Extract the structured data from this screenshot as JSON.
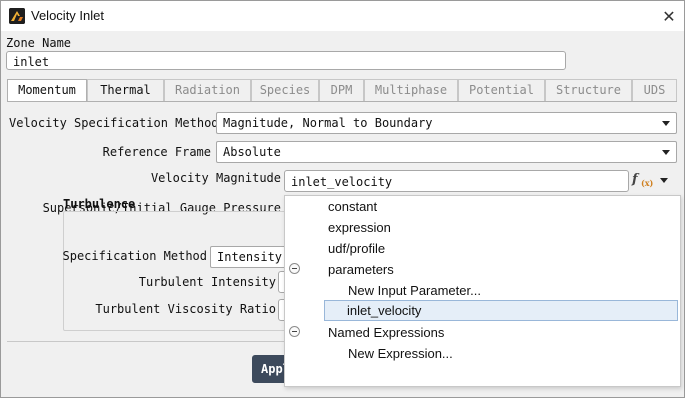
{
  "window": {
    "title": "Velocity Inlet",
    "close_glyph": "✕"
  },
  "zone": {
    "label": "Zone Name",
    "value": "inlet"
  },
  "tabs": [
    {
      "label": "Momentum",
      "active": true
    },
    {
      "label": "Thermal",
      "active": false
    },
    {
      "label": "Radiation",
      "active": false
    },
    {
      "label": "Species",
      "active": false
    },
    {
      "label": "DPM",
      "active": false
    },
    {
      "label": "Multiphase",
      "active": false
    },
    {
      "label": "Potential",
      "active": false
    },
    {
      "label": "Structure",
      "active": false
    },
    {
      "label": "UDS",
      "active": false
    }
  ],
  "momentum": {
    "velocity_spec_label": "Velocity Specification Method",
    "velocity_spec_value": "Magnitude, Normal to Boundary",
    "ref_frame_label": "Reference Frame",
    "ref_frame_value": "Absolute",
    "vel_mag_label": "Velocity Magnitude",
    "vel_mag_value": "inlet_velocity",
    "supersonic_label": "Supersonic/Initial Gauge Pressure",
    "turbulence_title": "Turbulence",
    "spec_method_label": "Specification Method",
    "spec_method_value": "Intensity",
    "turb_intensity_label": "Turbulent Intensity",
    "turb_visc_label": "Turbulent Viscosity Ratio"
  },
  "buttons": {
    "apply": "Apply"
  },
  "icons": {
    "app": "fluent-logo-icon",
    "fx": "expression-fx-icon"
  },
  "popup_menu": {
    "items": [
      {
        "label": "constant",
        "level": 0
      },
      {
        "label": "expression",
        "level": 0
      },
      {
        "label": "udf/profile",
        "level": 0
      },
      {
        "label": "parameters",
        "level": 0,
        "collapsible": true
      },
      {
        "label": "New Input Parameter...",
        "level": 1
      },
      {
        "label": "inlet_velocity",
        "level": 1,
        "highlighted": true
      },
      {
        "label": "Named Expressions",
        "level": 0,
        "collapsible": true
      },
      {
        "label": "New Expression...",
        "level": 1
      }
    ]
  },
  "colors": {
    "highlight_bg": "#e5eef8",
    "highlight_border": "#99b7d9",
    "apply_bg": "#3d4a5c"
  }
}
